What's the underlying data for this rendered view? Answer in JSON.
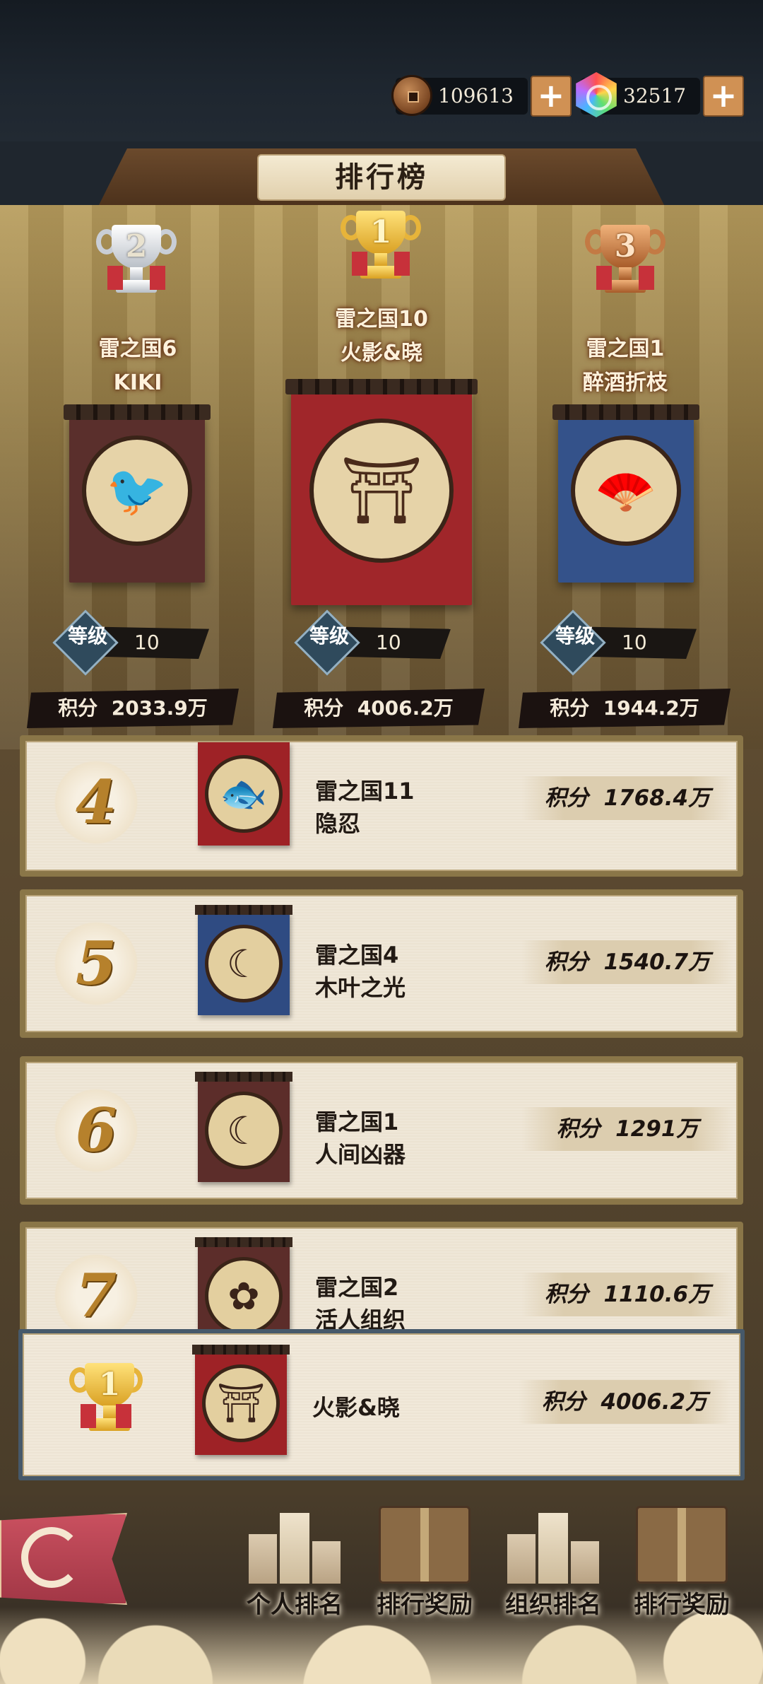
{
  "header": {
    "title": "排行榜",
    "coins": "109613",
    "gems": "32517",
    "plus_label": "+"
  },
  "top3": [
    {
      "rank": "2",
      "server": "雷之国6",
      "name": "KIKI",
      "level_label": "等级",
      "level": "10",
      "score_label": "积分",
      "score": "2033.9万",
      "emblem": "bird-icon",
      "color": "#5a2f2c"
    },
    {
      "rank": "1",
      "server": "雷之国10",
      "name": "火影&晓",
      "level_label": "等级",
      "level": "10",
      "score_label": "积分",
      "score": "4006.2万",
      "emblem": "torii-icon",
      "color": "#a0262a"
    },
    {
      "rank": "3",
      "server": "雷之国1",
      "name": "醉酒折枝",
      "level_label": "等级",
      "level": "10",
      "score_label": "积分",
      "score": "1944.2万",
      "emblem": "fan-icon",
      "color": "#34528a"
    }
  ],
  "list": [
    {
      "rank": "4",
      "server": "雷之国11",
      "name": "隐忍",
      "score_label": "积分",
      "score": "1768.4万",
      "emblem": "koi-icon",
      "color": "#9e2226"
    },
    {
      "rank": "5",
      "server": "雷之国4",
      "name": "木叶之光",
      "score_label": "积分",
      "score": "1540.7万",
      "emblem": "moon-icon",
      "color": "#2f4b82"
    },
    {
      "rank": "6",
      "server": "雷之国1",
      "name": "人间凶器",
      "score_label": "积分",
      "score": "1291万",
      "emblem": "moon-icon",
      "color": "#5c2d2a"
    },
    {
      "rank": "7",
      "server": "雷之国2",
      "name": "活人组织",
      "score_label": "积分",
      "score": "1110.6万",
      "emblem": "sakura-icon",
      "color": "#5c2d2a"
    }
  ],
  "self": {
    "rank": "1",
    "name": "火影&晓",
    "score_label": "积分",
    "score": "4006.2万",
    "emblem": "torii-icon",
    "color": "#9e2226"
  },
  "bottom_nav": [
    {
      "label": "个人排名",
      "icon": "podium-icon"
    },
    {
      "label": "排行奖励",
      "icon": "gift-box-icon"
    },
    {
      "label": "组织排名",
      "icon": "podium-icon"
    },
    {
      "label": "排行奖励",
      "icon": "gift-box-icon"
    }
  ],
  "podium_digits": [
    "2",
    "1",
    "3"
  ]
}
